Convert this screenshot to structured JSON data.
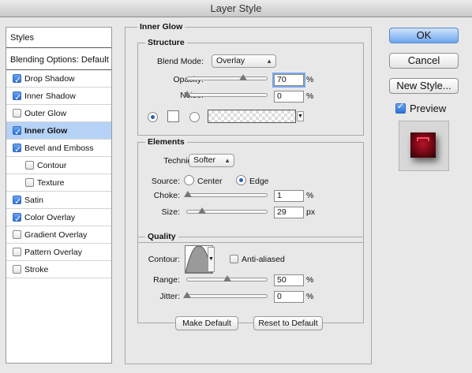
{
  "window": {
    "title": "Layer Style"
  },
  "styles_list": {
    "header": "Styles",
    "blending": "Blending Options: Default",
    "items": [
      {
        "label": "Drop Shadow",
        "checked": true
      },
      {
        "label": "Inner Shadow",
        "checked": true
      },
      {
        "label": "Outer Glow",
        "checked": false
      },
      {
        "label": "Inner Glow",
        "checked": true,
        "selected": true
      },
      {
        "label": "Bevel and Emboss",
        "checked": true
      },
      {
        "label": "Contour",
        "checked": false,
        "sub": true
      },
      {
        "label": "Texture",
        "checked": false,
        "sub": true
      },
      {
        "label": "Satin",
        "checked": true
      },
      {
        "label": "Color Overlay",
        "checked": true
      },
      {
        "label": "Gradient Overlay",
        "checked": false
      },
      {
        "label": "Pattern Overlay",
        "checked": false
      },
      {
        "label": "Stroke",
        "checked": false
      }
    ]
  },
  "panel": {
    "title": "Inner Glow",
    "structure": {
      "legend": "Structure",
      "blend_mode_label": "Blend Mode:",
      "blend_mode": "Overlay",
      "opacity_label": "Opacity:",
      "opacity": "70",
      "opacity_unit": "%",
      "noise_label": "Noise:",
      "noise": "0",
      "noise_unit": "%"
    },
    "elements": {
      "legend": "Elements",
      "technique_label": "Technique:",
      "technique": "Softer",
      "source_label": "Source:",
      "source_center": "Center",
      "source_edge": "Edge",
      "choke_label": "Choke:",
      "choke": "1",
      "choke_unit": "%",
      "size_label": "Size:",
      "size": "29",
      "size_unit": "px"
    },
    "quality": {
      "legend": "Quality",
      "contour_label": "Contour:",
      "antialiased_label": "Anti-aliased",
      "range_label": "Range:",
      "range": "50",
      "range_unit": "%",
      "jitter_label": "Jitter:",
      "jitter": "0",
      "jitter_unit": "%"
    },
    "make_default": "Make Default",
    "reset_default": "Reset to Default"
  },
  "buttons": {
    "ok": "OK",
    "cancel": "Cancel",
    "new_style": "New Style...",
    "preview": "Preview"
  },
  "colors": {
    "accent": "#2c6fd8",
    "selected_row": "#b6d2f6",
    "preview_red": "#b8132a"
  }
}
